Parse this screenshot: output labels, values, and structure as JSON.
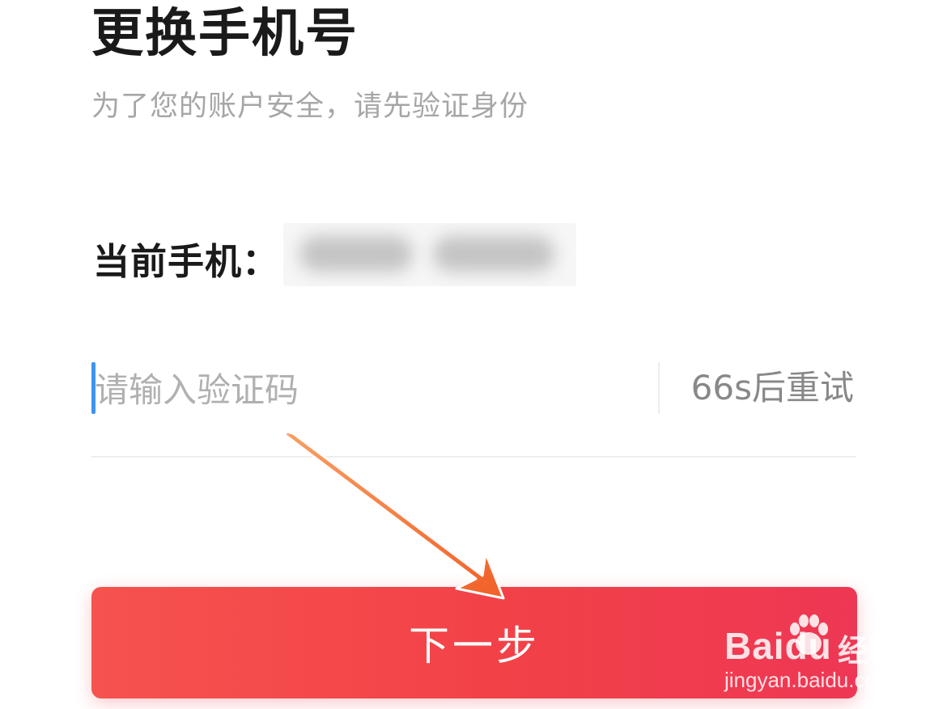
{
  "header": {
    "title": "更换手机号",
    "subtitle": "为了您的账户安全，请先验证身份"
  },
  "current_phone": {
    "label": "当前手机："
  },
  "verification": {
    "placeholder": "请输入验证码",
    "value": "",
    "retry_countdown": "66s后重试"
  },
  "actions": {
    "next_label": "下一步"
  },
  "colors": {
    "primary_button": "#f24148",
    "caret": "#3e95ec",
    "annotation_arrow": "#f26a34"
  },
  "watermark": {
    "logo": "Baidu",
    "brand": "经验",
    "url": "jingyan.baidu.com"
  }
}
